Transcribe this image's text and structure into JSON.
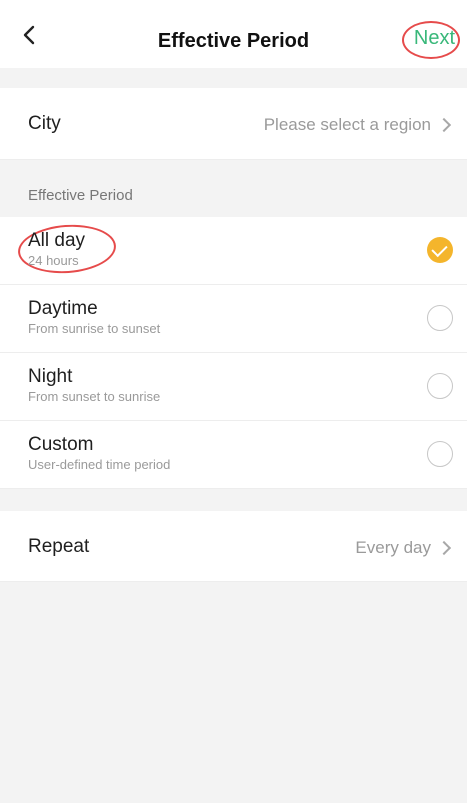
{
  "header": {
    "title": "Effective Period",
    "next_label": "Next"
  },
  "city": {
    "label": "City",
    "value": "Please select a region"
  },
  "period_section": {
    "header": "Effective Period",
    "options": [
      {
        "title": "All day",
        "subtitle": "24 hours",
        "selected": true
      },
      {
        "title": "Daytime",
        "subtitle": "From sunrise to sunset",
        "selected": false
      },
      {
        "title": "Night",
        "subtitle": "From sunset to sunrise",
        "selected": false
      },
      {
        "title": "Custom",
        "subtitle": "User-defined time period",
        "selected": false
      }
    ]
  },
  "repeat": {
    "label": "Repeat",
    "value": "Every day"
  },
  "colors": {
    "accent_green": "#39b87a",
    "selected_yellow": "#f4b52c",
    "annotation_red": "#e64b4b",
    "background": "#f3f3f3"
  },
  "icons": {
    "back": "chevron-left-icon",
    "row_arrow": "chevron-right-icon",
    "selected": "check-circle-icon",
    "unselected": "radio-empty-icon"
  }
}
